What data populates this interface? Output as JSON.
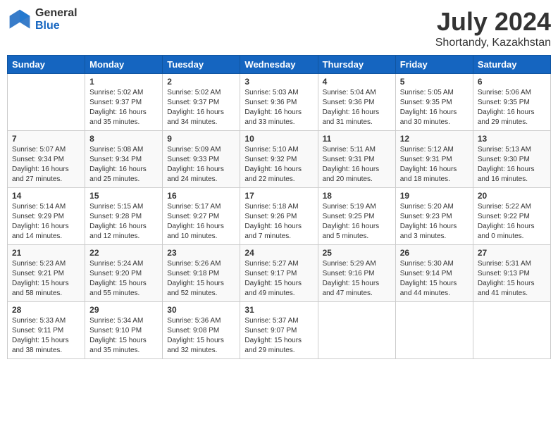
{
  "header": {
    "logo_general": "General",
    "logo_blue": "Blue",
    "month_title": "July 2024",
    "location": "Shortandy, Kazakhstan"
  },
  "days_of_week": [
    "Sunday",
    "Monday",
    "Tuesday",
    "Wednesday",
    "Thursday",
    "Friday",
    "Saturday"
  ],
  "weeks": [
    [
      {
        "day": "",
        "info": ""
      },
      {
        "day": "1",
        "info": "Sunrise: 5:02 AM\nSunset: 9:37 PM\nDaylight: 16 hours\nand 35 minutes."
      },
      {
        "day": "2",
        "info": "Sunrise: 5:02 AM\nSunset: 9:37 PM\nDaylight: 16 hours\nand 34 minutes."
      },
      {
        "day": "3",
        "info": "Sunrise: 5:03 AM\nSunset: 9:36 PM\nDaylight: 16 hours\nand 33 minutes."
      },
      {
        "day": "4",
        "info": "Sunrise: 5:04 AM\nSunset: 9:36 PM\nDaylight: 16 hours\nand 31 minutes."
      },
      {
        "day": "5",
        "info": "Sunrise: 5:05 AM\nSunset: 9:35 PM\nDaylight: 16 hours\nand 30 minutes."
      },
      {
        "day": "6",
        "info": "Sunrise: 5:06 AM\nSunset: 9:35 PM\nDaylight: 16 hours\nand 29 minutes."
      }
    ],
    [
      {
        "day": "7",
        "info": "Sunrise: 5:07 AM\nSunset: 9:34 PM\nDaylight: 16 hours\nand 27 minutes."
      },
      {
        "day": "8",
        "info": "Sunrise: 5:08 AM\nSunset: 9:34 PM\nDaylight: 16 hours\nand 25 minutes."
      },
      {
        "day": "9",
        "info": "Sunrise: 5:09 AM\nSunset: 9:33 PM\nDaylight: 16 hours\nand 24 minutes."
      },
      {
        "day": "10",
        "info": "Sunrise: 5:10 AM\nSunset: 9:32 PM\nDaylight: 16 hours\nand 22 minutes."
      },
      {
        "day": "11",
        "info": "Sunrise: 5:11 AM\nSunset: 9:31 PM\nDaylight: 16 hours\nand 20 minutes."
      },
      {
        "day": "12",
        "info": "Sunrise: 5:12 AM\nSunset: 9:31 PM\nDaylight: 16 hours\nand 18 minutes."
      },
      {
        "day": "13",
        "info": "Sunrise: 5:13 AM\nSunset: 9:30 PM\nDaylight: 16 hours\nand 16 minutes."
      }
    ],
    [
      {
        "day": "14",
        "info": "Sunrise: 5:14 AM\nSunset: 9:29 PM\nDaylight: 16 hours\nand 14 minutes."
      },
      {
        "day": "15",
        "info": "Sunrise: 5:15 AM\nSunset: 9:28 PM\nDaylight: 16 hours\nand 12 minutes."
      },
      {
        "day": "16",
        "info": "Sunrise: 5:17 AM\nSunset: 9:27 PM\nDaylight: 16 hours\nand 10 minutes."
      },
      {
        "day": "17",
        "info": "Sunrise: 5:18 AM\nSunset: 9:26 PM\nDaylight: 16 hours\nand 7 minutes."
      },
      {
        "day": "18",
        "info": "Sunrise: 5:19 AM\nSunset: 9:25 PM\nDaylight: 16 hours\nand 5 minutes."
      },
      {
        "day": "19",
        "info": "Sunrise: 5:20 AM\nSunset: 9:23 PM\nDaylight: 16 hours\nand 3 minutes."
      },
      {
        "day": "20",
        "info": "Sunrise: 5:22 AM\nSunset: 9:22 PM\nDaylight: 16 hours\nand 0 minutes."
      }
    ],
    [
      {
        "day": "21",
        "info": "Sunrise: 5:23 AM\nSunset: 9:21 PM\nDaylight: 15 hours\nand 58 minutes."
      },
      {
        "day": "22",
        "info": "Sunrise: 5:24 AM\nSunset: 9:20 PM\nDaylight: 15 hours\nand 55 minutes."
      },
      {
        "day": "23",
        "info": "Sunrise: 5:26 AM\nSunset: 9:18 PM\nDaylight: 15 hours\nand 52 minutes."
      },
      {
        "day": "24",
        "info": "Sunrise: 5:27 AM\nSunset: 9:17 PM\nDaylight: 15 hours\nand 49 minutes."
      },
      {
        "day": "25",
        "info": "Sunrise: 5:29 AM\nSunset: 9:16 PM\nDaylight: 15 hours\nand 47 minutes."
      },
      {
        "day": "26",
        "info": "Sunrise: 5:30 AM\nSunset: 9:14 PM\nDaylight: 15 hours\nand 44 minutes."
      },
      {
        "day": "27",
        "info": "Sunrise: 5:31 AM\nSunset: 9:13 PM\nDaylight: 15 hours\nand 41 minutes."
      }
    ],
    [
      {
        "day": "28",
        "info": "Sunrise: 5:33 AM\nSunset: 9:11 PM\nDaylight: 15 hours\nand 38 minutes."
      },
      {
        "day": "29",
        "info": "Sunrise: 5:34 AM\nSunset: 9:10 PM\nDaylight: 15 hours\nand 35 minutes."
      },
      {
        "day": "30",
        "info": "Sunrise: 5:36 AM\nSunset: 9:08 PM\nDaylight: 15 hours\nand 32 minutes."
      },
      {
        "day": "31",
        "info": "Sunrise: 5:37 AM\nSunset: 9:07 PM\nDaylight: 15 hours\nand 29 minutes."
      },
      {
        "day": "",
        "info": ""
      },
      {
        "day": "",
        "info": ""
      },
      {
        "day": "",
        "info": ""
      }
    ]
  ]
}
